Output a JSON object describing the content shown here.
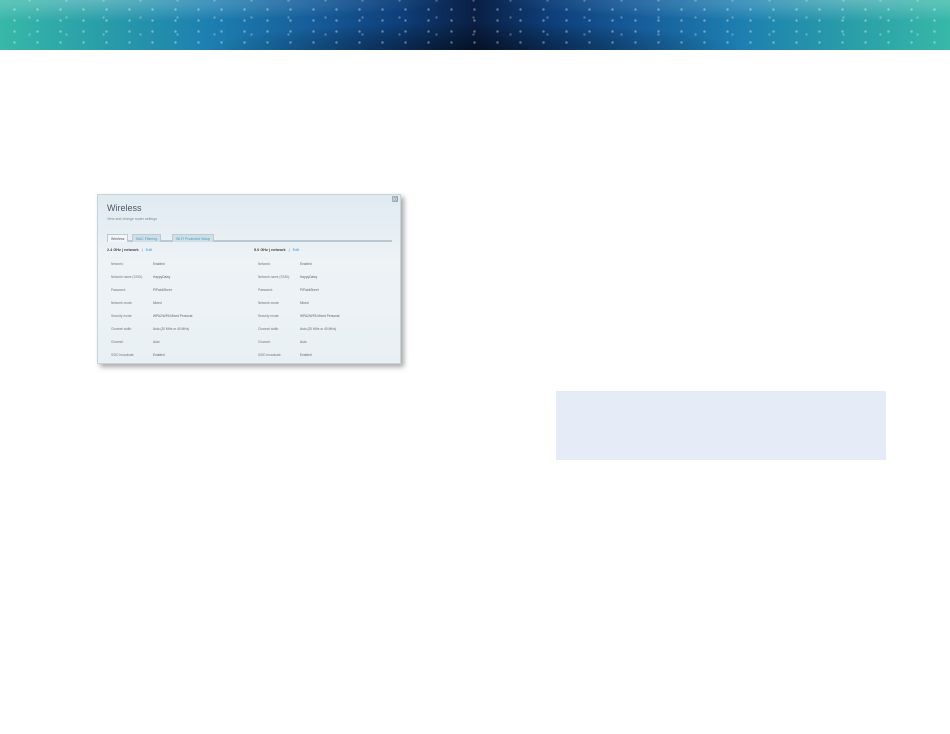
{
  "banner": {
    "icon": "starfield-banner"
  },
  "panel": {
    "title": "Wireless",
    "subtitle": "View and change router settings",
    "close_label": "⊠",
    "tabs": [
      {
        "label": "Wireless",
        "active": true
      },
      {
        "label": "MAC Filtering",
        "active": false
      },
      {
        "label": "Wi-Fi Protected Setup",
        "active": false
      }
    ],
    "networks": [
      {
        "heading": "2.4 GHz | network",
        "separator": "|",
        "edit_label": "Edit",
        "rows": [
          {
            "label": "Network:",
            "value": "Enabled"
          },
          {
            "label": "Network name (SSID):",
            "value": "HappyDaisy"
          },
          {
            "label": "Password:",
            "value": "PIPaintSheet"
          },
          {
            "label": "Network mode:",
            "value": "Mixed"
          },
          {
            "label": "Security mode:",
            "value": "WPA2/WPA Mixed Personal"
          },
          {
            "label": "Channel width:",
            "value": "Auto (20 MHz or 40 MHz)"
          },
          {
            "label": "Channel:",
            "value": "Auto"
          },
          {
            "label": "SSID broadcast:",
            "value": "Enabled"
          }
        ]
      },
      {
        "heading": "5.0 GHz | network",
        "separator": "|",
        "edit_label": "Edit",
        "rows": [
          {
            "label": "Network:",
            "value": "Enabled"
          },
          {
            "label": "Network name (SSID):",
            "value": "HappyDaisy"
          },
          {
            "label": "Password:",
            "value": "PIPaintSheet"
          },
          {
            "label": "Network mode:",
            "value": "Mixed"
          },
          {
            "label": "Security mode:",
            "value": "WPA2/WPA Mixed Personal"
          },
          {
            "label": "Channel width:",
            "value": "Auto (20 MHz or 40 MHz)"
          },
          {
            "label": "Channel:",
            "value": "Auto"
          },
          {
            "label": "SSID broadcast:",
            "value": "Enabled"
          }
        ]
      }
    ]
  },
  "colors": {
    "callout_bg": "#e6ebf8",
    "link": "#3f96c8"
  }
}
